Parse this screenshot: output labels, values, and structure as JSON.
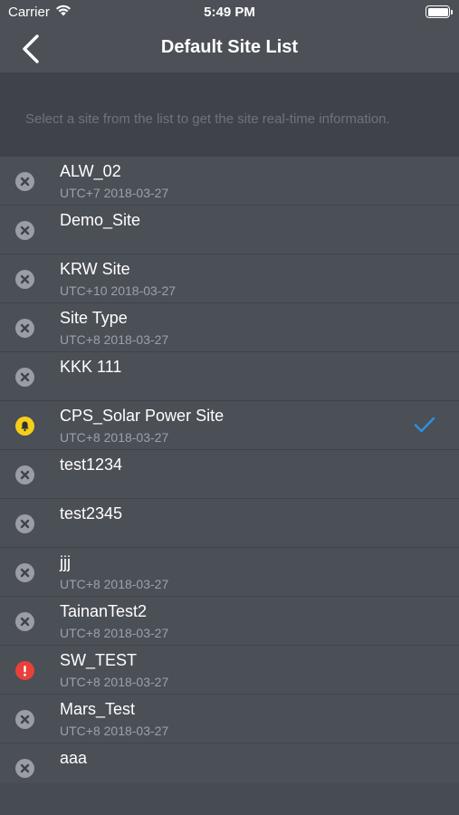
{
  "status_bar": {
    "carrier": "Carrier",
    "time": "5:49 PM",
    "wifi_icon": "wifi-icon",
    "battery_icon": "battery-icon"
  },
  "nav": {
    "back_icon": "chevron-left-icon",
    "title": "Default Site List"
  },
  "instruction": "Select a site from the list to get the site real-time information.",
  "colors": {
    "normal": "#9a9ea4",
    "warning": "#f5cf1a",
    "error": "#e8403a",
    "check": "#2d8fe0"
  },
  "sites": [
    {
      "name": "ALW_02",
      "sub": "UTC+7 2018-03-27",
      "status": "normal",
      "selected": false
    },
    {
      "name": "Demo_Site",
      "sub": "",
      "status": "normal",
      "selected": false
    },
    {
      "name": "KRW Site",
      "sub": "UTC+10 2018-03-27",
      "status": "normal",
      "selected": false
    },
    {
      "name": "Site Type",
      "sub": "UTC+8 2018-03-27",
      "status": "normal",
      "selected": false
    },
    {
      "name": "KKK 111",
      "sub": "",
      "status": "normal",
      "selected": false
    },
    {
      "name": "CPS_Solar Power Site",
      "sub": "UTC+8 2018-03-27",
      "status": "warning",
      "selected": true
    },
    {
      "name": "test1234",
      "sub": "",
      "status": "normal",
      "selected": false
    },
    {
      "name": "test2345",
      "sub": "",
      "status": "normal",
      "selected": false
    },
    {
      "name": "jjj",
      "sub": "UTC+8 2018-03-27",
      "status": "normal",
      "selected": false
    },
    {
      "name": "TainanTest2",
      "sub": "UTC+8 2018-03-27",
      "status": "normal",
      "selected": false
    },
    {
      "name": "SW_TEST",
      "sub": "UTC+8 2018-03-27",
      "status": "error",
      "selected": false
    },
    {
      "name": "Mars_Test",
      "sub": "UTC+8 2018-03-27",
      "status": "normal",
      "selected": false
    },
    {
      "name": "aaa",
      "sub": "",
      "status": "normal",
      "selected": false
    }
  ]
}
